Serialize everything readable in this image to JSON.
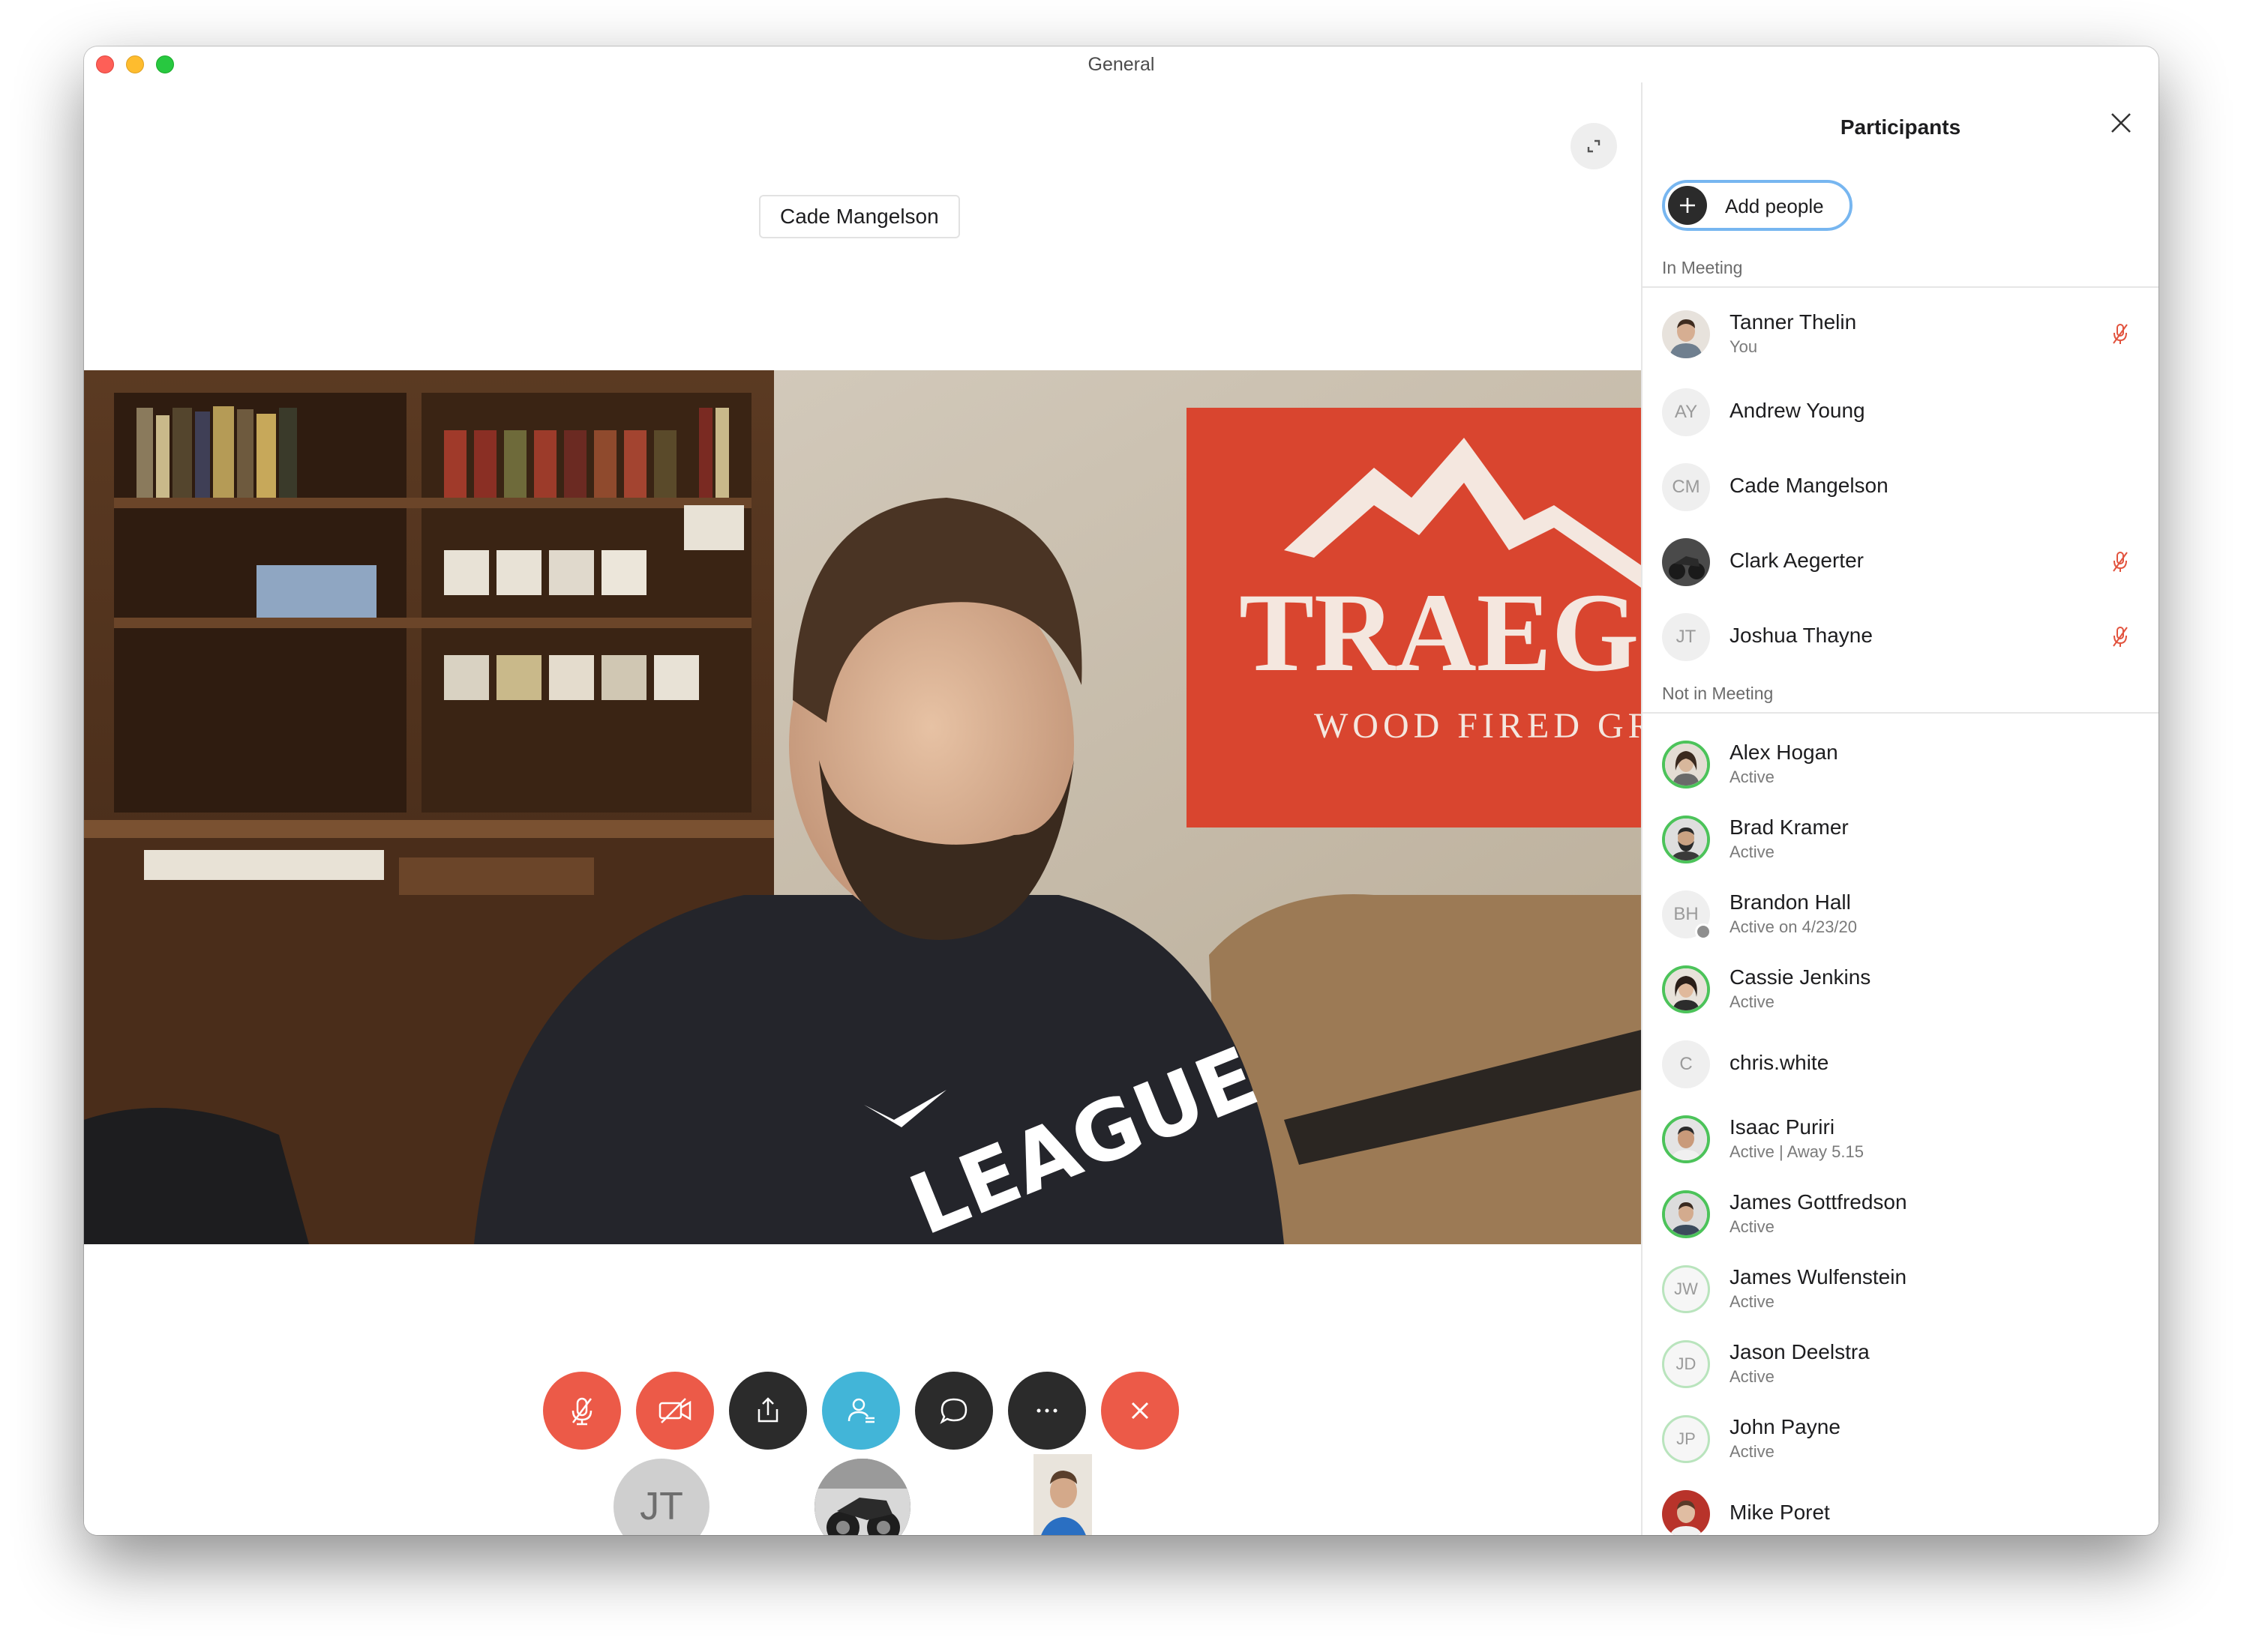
{
  "window": {
    "title": "General"
  },
  "stage": {
    "active_speaker": "Cade Mangelson",
    "video_banner": {
      "line1": "TRAEG",
      "line2": "WOOD FIRED GR"
    },
    "shirt_text": "LEAGUE",
    "controls": [
      {
        "name": "mute-button",
        "icon": "mic-off-icon",
        "color": "#ec5a48"
      },
      {
        "name": "video-button",
        "icon": "video-off-icon",
        "color": "#ec5a48"
      },
      {
        "name": "share-button",
        "icon": "share-icon",
        "color": "#2b2b2b"
      },
      {
        "name": "participants-button",
        "icon": "participants-icon",
        "color": "#42b5d8"
      },
      {
        "name": "chat-button",
        "icon": "chat-icon",
        "color": "#2b2b2b"
      },
      {
        "name": "more-button",
        "icon": "more-icon",
        "color": "#2b2b2b"
      },
      {
        "name": "end-call-button",
        "icon": "close-icon",
        "color": "#ec5a48"
      }
    ],
    "thumbnails": {
      "initials": "JT"
    }
  },
  "sidebar": {
    "title": "Participants",
    "add_label": "Add people",
    "in_meeting_label": "In Meeting",
    "not_in_meeting_label": "Not in Meeting",
    "in_meeting": [
      {
        "name": "Tanner Thelin",
        "status": "You",
        "avatar": "photo",
        "muted": true
      },
      {
        "name": "Andrew Young",
        "status": "",
        "avatar": "initials",
        "initials": "AY",
        "muted": false
      },
      {
        "name": "Cade Mangelson",
        "status": "",
        "avatar": "initials",
        "initials": "CM",
        "muted": false
      },
      {
        "name": "Clark Aegerter",
        "status": "",
        "avatar": "photo",
        "muted": true
      },
      {
        "name": "Joshua Thayne",
        "status": "",
        "avatar": "initials",
        "initials": "JT",
        "muted": true
      }
    ],
    "not_in_meeting": [
      {
        "name": "Alex Hogan",
        "status": "Active",
        "avatar": "photo"
      },
      {
        "name": "Brad Kramer",
        "status": "Active",
        "avatar": "photo"
      },
      {
        "name": "Brandon Hall",
        "status": "Active on 4/23/20",
        "avatar": "initials",
        "initials": "BH"
      },
      {
        "name": "Cassie Jenkins",
        "status": "Active",
        "avatar": "photo"
      },
      {
        "name": "chris.white",
        "status": "",
        "avatar": "initials",
        "initials": "C"
      },
      {
        "name": "Isaac Puriri",
        "status": "Active | Away 5.15",
        "avatar": "photo"
      },
      {
        "name": "James Gottfredson",
        "status": "Active",
        "avatar": "photo"
      },
      {
        "name": "James Wulfenstein",
        "status": "Active",
        "avatar": "initials",
        "initials": "JW"
      },
      {
        "name": "Jason Deelstra",
        "status": "Active",
        "avatar": "initials",
        "initials": "JD"
      },
      {
        "name": "John Payne",
        "status": "Active",
        "avatar": "initials",
        "initials": "JP"
      },
      {
        "name": "Mike Poret",
        "status": "",
        "avatar": "photo"
      }
    ]
  }
}
